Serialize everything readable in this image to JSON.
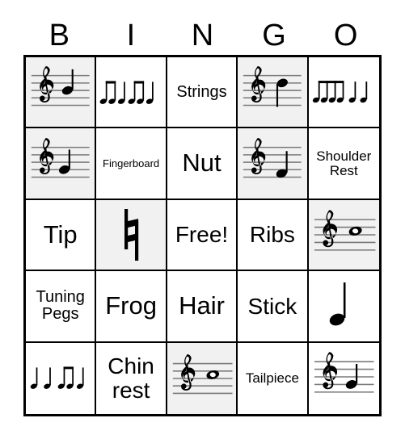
{
  "card": {
    "header": {
      "letters": [
        "B",
        "I",
        "N",
        "G",
        "O"
      ]
    },
    "colors": {
      "shaded_cell_bg": "#f1f1f1",
      "cell_bg": "#ffffff",
      "border": "#000000",
      "staff_line": "#7a7a7a",
      "note": "#000000"
    },
    "rows": [
      {
        "cells": [
          {
            "type": "music",
            "kind": "staff-note",
            "shaded": true,
            "label": "treble-staff-note-middle",
            "notes": [
              "quarter note on 3rd line with upward stem"
            ]
          },
          {
            "type": "music",
            "kind": "rhythm",
            "shaded": false,
            "label": "rhythm-beamed-eighths-quarter-pair",
            "notes": [
              "two beamed eighth notes",
              "quarter note",
              "two beamed eighth notes",
              "quarter note"
            ]
          },
          {
            "type": "text",
            "text": "Strings",
            "shaded": false,
            "size": "size-md"
          },
          {
            "type": "music",
            "kind": "staff-note",
            "shaded": true,
            "label": "treble-staff-note-high",
            "notes": [
              "quarter note on 4th line with downward stem"
            ]
          },
          {
            "type": "music",
            "kind": "rhythm",
            "shaded": false,
            "label": "rhythm-four-beamed-eighths-two-quarters",
            "notes": [
              "four beamed eighth notes",
              "quarter note",
              "quarter note"
            ]
          }
        ]
      },
      {
        "cells": [
          {
            "type": "music",
            "kind": "staff-note",
            "shaded": true,
            "label": "treble-staff-note-low-space",
            "notes": [
              "quarter note on 1st space with upward stem"
            ]
          },
          {
            "type": "text",
            "text": "Fingerboard",
            "shaded": false,
            "size": "size-xs"
          },
          {
            "type": "text",
            "text": "Nut",
            "shaded": false,
            "size": "size-xl"
          },
          {
            "type": "music",
            "kind": "staff-note",
            "shaded": true,
            "label": "treble-staff-note-bottom",
            "notes": [
              "quarter note below middle with downward stem"
            ]
          },
          {
            "type": "text",
            "text": "Shoulder Rest",
            "shaded": false,
            "size": "size-sm"
          }
        ]
      },
      {
        "cells": [
          {
            "type": "text",
            "text": "Tip",
            "shaded": false,
            "size": "size-xl"
          },
          {
            "type": "music",
            "kind": "natural",
            "shaded": true,
            "label": "natural-sign",
            "notes": [
              "natural accidental sign"
            ]
          },
          {
            "type": "text",
            "text": "Free!",
            "shaded": false,
            "size": "size-lg"
          },
          {
            "type": "text",
            "text": "Ribs",
            "shaded": false,
            "size": "size-lg"
          },
          {
            "type": "music",
            "kind": "staff-whole",
            "shaded": true,
            "label": "treble-staff-whole-note",
            "notes": [
              "whole note on 3rd space"
            ]
          }
        ]
      },
      {
        "cells": [
          {
            "type": "text",
            "text": "Tuning Pegs",
            "shaded": false,
            "size": "size-md"
          },
          {
            "type": "text",
            "text": "Frog",
            "shaded": false,
            "size": "size-xl"
          },
          {
            "type": "text",
            "text": "Hair",
            "shaded": false,
            "size": "size-xl"
          },
          {
            "type": "text",
            "text": "Stick",
            "shaded": false,
            "size": "size-lg"
          },
          {
            "type": "music",
            "kind": "single-quarter",
            "shaded": false,
            "label": "single-quarter-note",
            "notes": [
              "quarter note"
            ]
          }
        ]
      },
      {
        "cells": [
          {
            "type": "music",
            "kind": "rhythm2",
            "shaded": false,
            "label": "rhythm-two-quarters-beamed-eighths-quarter",
            "notes": [
              "quarter note",
              "quarter note",
              "two beamed eighth notes",
              "quarter note"
            ]
          },
          {
            "type": "text",
            "text": "Chin rest",
            "shaded": false,
            "size": "size-lg"
          },
          {
            "type": "music",
            "kind": "staff-whole",
            "shaded": true,
            "label": "treble-staff-whole-note",
            "notes": [
              "whole note on 3rd space"
            ]
          },
          {
            "type": "text",
            "text": "Tailpiece",
            "shaded": false,
            "size": "size-sm"
          },
          {
            "type": "music",
            "kind": "staff-note",
            "shaded": false,
            "label": "treble-staff-note-low",
            "notes": [
              "quarter note on 1st space with upward stem"
            ]
          }
        ]
      }
    ]
  }
}
